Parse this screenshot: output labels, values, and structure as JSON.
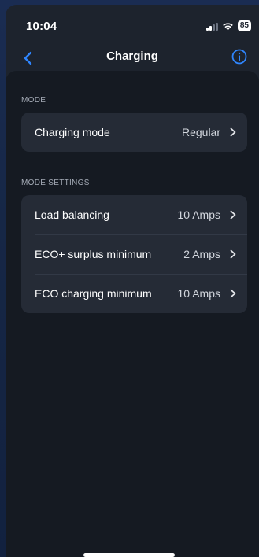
{
  "status_bar": {
    "time": "10:04",
    "battery": "85"
  },
  "nav": {
    "title": "Charging"
  },
  "sections": [
    {
      "label": "MODE",
      "rows": [
        {
          "label": "Charging mode",
          "value": "Regular"
        }
      ]
    },
    {
      "label": "MODE SETTINGS",
      "rows": [
        {
          "label": "Load balancing",
          "value": "10 Amps"
        },
        {
          "label": "ECO+ surplus minimum",
          "value": "2 Amps"
        },
        {
          "label": "ECO charging minimum",
          "value": "10 Amps"
        }
      ]
    }
  ],
  "colors": {
    "accent": "#2f86ff",
    "background": "#151a22",
    "card": "#252b36"
  },
  "icons": [
    "back-chevron-icon",
    "info-icon",
    "chevron-right-icon",
    "signal-icon",
    "wifi-icon",
    "battery-icon"
  ]
}
